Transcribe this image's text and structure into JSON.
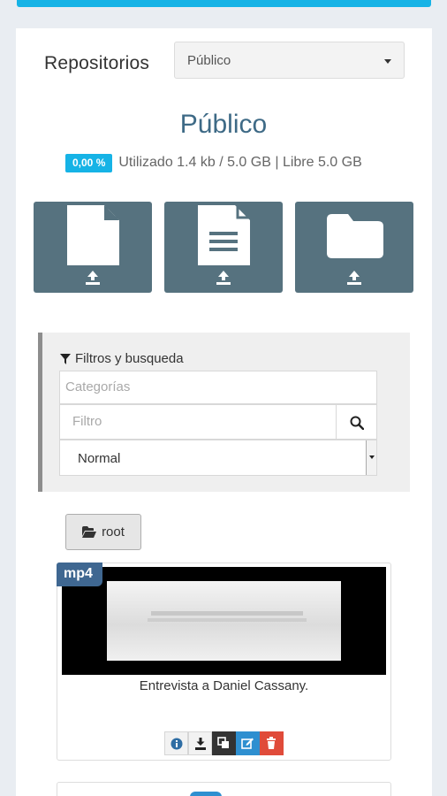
{
  "repository": {
    "label": "Repositorios",
    "selected": "Público",
    "title": "Público"
  },
  "usage": {
    "percent_badge": "0,00 %",
    "text": "Utilizado 1.4 kb / 5.0 GB | Libre 5.0 GB"
  },
  "upload_buttons": [
    {
      "icon": "file-upload-icon"
    },
    {
      "icon": "document-upload-icon"
    },
    {
      "icon": "folder-upload-icon"
    }
  ],
  "filters": {
    "title": "Filtros y busqueda",
    "categories_placeholder": "Categorías",
    "filter_placeholder": "Filtro",
    "sort_selected": "Normal"
  },
  "breadcrumb": {
    "root_label": "root"
  },
  "files": [
    {
      "type": "mp4",
      "title": "Entrevista a Daniel Cassany."
    }
  ],
  "colors": {
    "accent": "#16b3e6",
    "upload_button": "#56727f",
    "title": "#3e6a86",
    "badge": "#3f6791",
    "edit": "#2e8fd0",
    "delete": "#e04b3a"
  }
}
